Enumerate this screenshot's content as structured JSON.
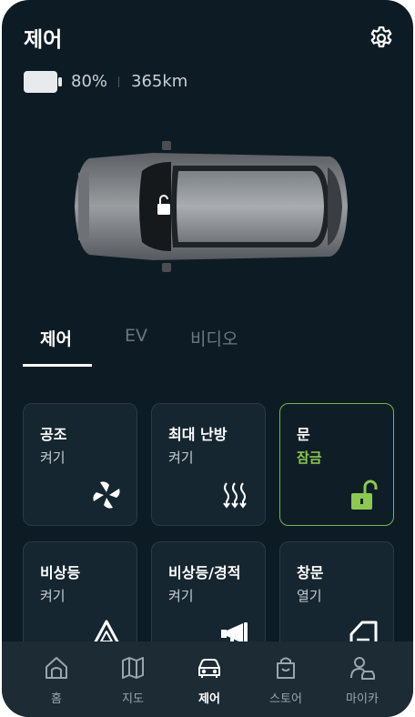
{
  "header": {
    "title": "제어"
  },
  "status": {
    "battery": "80%",
    "range": "365km"
  },
  "tabs": [
    {
      "label": "제어",
      "active": true
    },
    {
      "label": "EV",
      "active": false
    },
    {
      "label": "비디오",
      "active": false
    }
  ],
  "cards": [
    {
      "title": "공조",
      "sub": "켜기",
      "icon": "fan-icon"
    },
    {
      "title": "최대 난방",
      "sub": "켜기",
      "icon": "heat-icon"
    },
    {
      "title": "문",
      "sub": "잠금",
      "icon": "unlock-icon",
      "active": true
    },
    {
      "title": "비상등",
      "sub": "켜기",
      "icon": "hazard-icon"
    },
    {
      "title": "비상등/경적",
      "sub": "켜기",
      "icon": "horn-icon"
    },
    {
      "title": "창문",
      "sub": "열기",
      "icon": "window-icon"
    }
  ],
  "nav": [
    {
      "label": "홈",
      "icon": "home-icon"
    },
    {
      "label": "지도",
      "icon": "map-icon"
    },
    {
      "label": "제어",
      "icon": "car-icon",
      "active": true
    },
    {
      "label": "스토어",
      "icon": "store-icon"
    },
    {
      "label": "마이카",
      "icon": "mycar-icon"
    }
  ],
  "colors": {
    "background": "#0d1b24",
    "accent": "#8cc852",
    "card": "#162630",
    "navbar": "#1c2b34"
  }
}
